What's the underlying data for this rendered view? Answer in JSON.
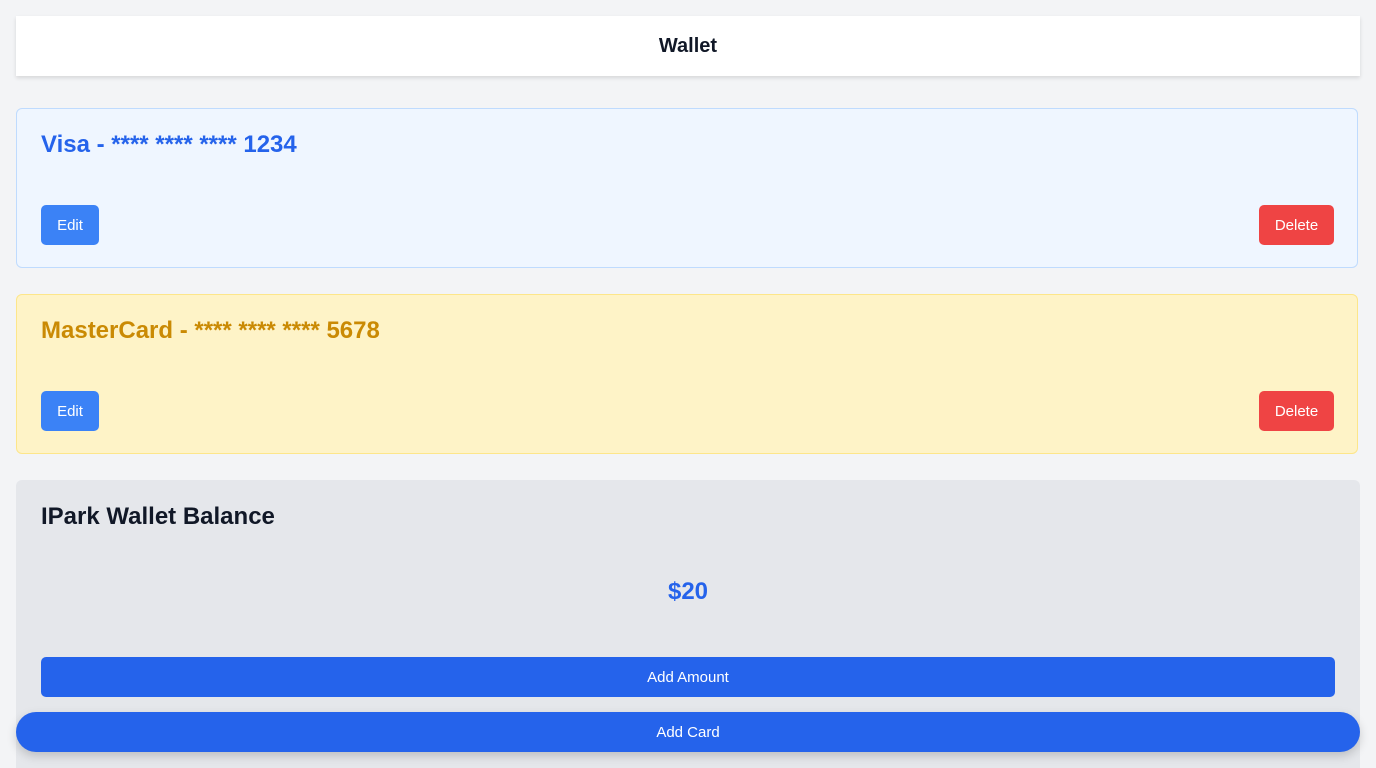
{
  "header": {
    "title": "Wallet"
  },
  "cards": [
    {
      "title": "Visa - **** **** **** 1234",
      "edit_label": "Edit",
      "delete_label": "Delete",
      "color": "#2563eb",
      "background": "#eff6ff"
    },
    {
      "title": "MasterCard - **** **** **** 5678",
      "edit_label": "Edit",
      "delete_label": "Delete",
      "color": "#ca8a04",
      "background": "#fef3c7"
    }
  ],
  "balance": {
    "title": "IPark Wallet Balance",
    "amount": "$20",
    "add_amount_label": "Add Amount"
  },
  "add_card_label": "Add Card",
  "colors": {
    "primary": "#2563eb",
    "edit": "#3b82f6",
    "delete": "#ef4444",
    "page_bg": "#f3f4f6"
  }
}
